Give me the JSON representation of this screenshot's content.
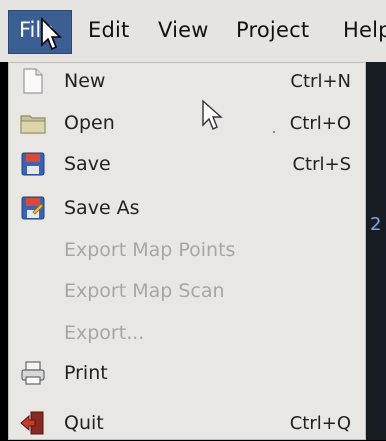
{
  "menubar": {
    "items": [
      {
        "label": "File"
      },
      {
        "label": "Edit"
      },
      {
        "label": "View"
      },
      {
        "label": "Project"
      },
      {
        "label": "Help"
      }
    ]
  },
  "file_menu": {
    "items": [
      {
        "label": "New",
        "shortcut": "Ctrl+N",
        "icon": "new-document-icon",
        "enabled": true
      },
      {
        "label": "Open",
        "shortcut": "Ctrl+O",
        "icon": "folder-icon",
        "enabled": true
      },
      {
        "label": "Save",
        "shortcut": "Ctrl+S",
        "icon": "save-icon",
        "enabled": true
      },
      {
        "label": "Save As",
        "shortcut": "",
        "icon": "save-as-icon",
        "enabled": true
      },
      {
        "label": "Export Map Points",
        "shortcut": "",
        "icon": "",
        "enabled": false
      },
      {
        "label": "Export Map Scan",
        "shortcut": "",
        "icon": "",
        "enabled": false
      },
      {
        "label": "Export...",
        "shortcut": "",
        "icon": "",
        "enabled": false
      },
      {
        "label": "Print",
        "shortcut": "",
        "icon": "printer-icon",
        "enabled": true
      },
      {
        "label": "Quit",
        "shortcut": "Ctrl+Q",
        "icon": "quit-icon",
        "enabled": true
      }
    ]
  },
  "background": {
    "glyph": "2"
  },
  "colors": {
    "menubar_bg": "#e6e4e0",
    "active_menu_bg": "#3b5f93",
    "menu_bg": "#e9e7e3",
    "disabled_text": "#a9a6a0"
  }
}
